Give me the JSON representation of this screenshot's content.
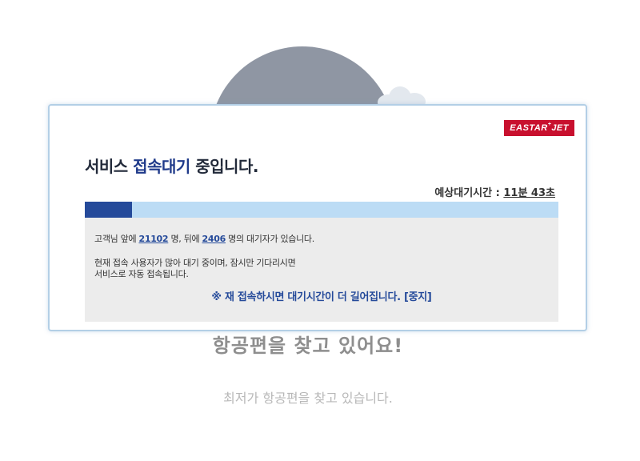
{
  "background": {
    "title": "항공편을 찾고 있어요!",
    "subtitle": "최저가 항공편을 찾고 있습니다."
  },
  "modal": {
    "logo": {
      "text": "EASTAR",
      "mark": "+",
      "suffix": "JET"
    },
    "heading_prefix": "서비스 ",
    "heading_accent": "접속대기",
    "heading_suffix": " 중입니다.",
    "eta_label": "예상대기시간 : ",
    "eta_value": "11분 43초",
    "progress_fraction": 0.1,
    "queue": {
      "before_text": "고객님 앞에 ",
      "ahead_count": "21102",
      "middle_text": " 명, 뒤에 ",
      "behind_count": "2406",
      "after_text": " 명의 대기자가 있습니다."
    },
    "notice_line1": "현재 접속 사용자가 많아 대기 중이며, 잠시만 기다리시면",
    "notice_line2": "서비스로 자동 접속됩니다.",
    "warning": "※ 재 접속하시면 대기시간이 더 길어집니다. [중지]"
  },
  "colors": {
    "brand_red": "#c8102e",
    "accent_blue": "#254a9a",
    "progress_track": "#bcdcf5"
  }
}
